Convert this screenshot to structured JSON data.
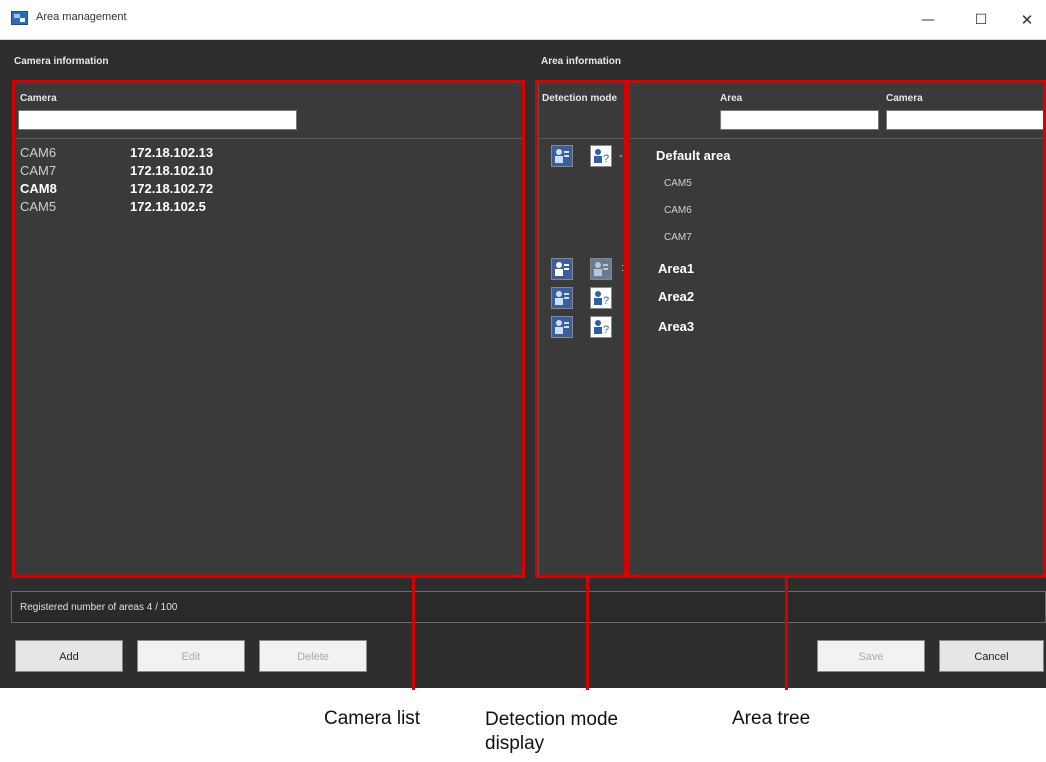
{
  "window": {
    "title": "Area management",
    "minimize": "—",
    "maximize": "☐",
    "close": "✕"
  },
  "camera_info": {
    "title": "Camera information",
    "column_header": "Camera",
    "filter_value": "",
    "cameras": [
      {
        "name": "CAM6",
        "ip": "172.18.102.13"
      },
      {
        "name": "CAM7",
        "ip": "172.18.102.10"
      },
      {
        "name": "CAM8",
        "ip": "172.18.102.72"
      },
      {
        "name": "CAM5",
        "ip": "172.18.102.5"
      }
    ]
  },
  "area_info": {
    "title": "Area information",
    "detection_mode_header": "Detection mode",
    "area_header": "Area",
    "camera_header": "Camera",
    "area_filter_value": "",
    "camera_filter_value": ""
  },
  "area_tree": {
    "default_area": {
      "name": "Default area",
      "cameras": [
        "CAM5",
        "CAM6",
        "CAM7"
      ]
    },
    "areas": [
      "Area1",
      "Area2",
      "Area3"
    ]
  },
  "status": {
    "text": "Registered number of areas 4 / 100"
  },
  "buttons": {
    "add": "Add",
    "edit": "Edit",
    "delete": "Delete",
    "save": "Save",
    "cancel": "Cancel"
  },
  "callouts": {
    "camera_list": "Camera list",
    "detection_mode": "Detection mode\ndisplay",
    "area_tree": "Area tree"
  },
  "colors": {
    "highlight": "#d60000",
    "panel": "#3a3a3a",
    "background": "#2e2e2e",
    "mode_icon_blue": "#3a5f9a"
  },
  "icons": {
    "app": "area-management-app-icon",
    "person_mode": "person-detect-icon",
    "unknown_mode": "person-question-icon"
  }
}
